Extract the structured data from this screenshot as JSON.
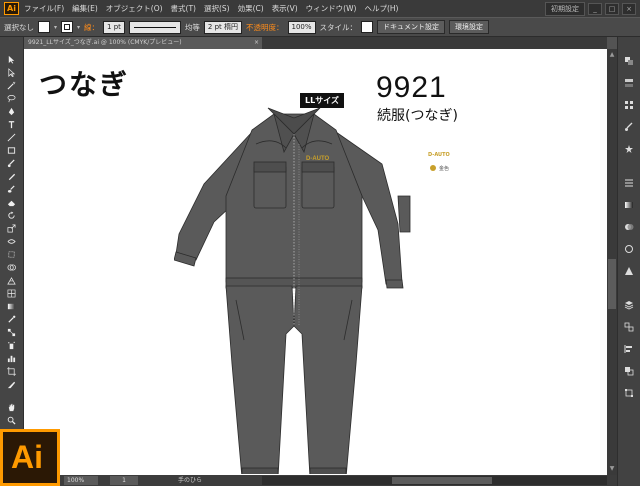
{
  "app": {
    "logo_text": "Ai",
    "accent_color": "#ff9a00"
  },
  "menu": {
    "items": [
      "ファイル(F)",
      "編集(E)",
      "オブジェクト(O)",
      "書式(T)",
      "選択(S)",
      "効果(C)",
      "表示(V)",
      "ウィンドウ(W)",
      "ヘルプ(H)"
    ],
    "workspace": "初期設定",
    "window_buttons": [
      "_",
      "□",
      "×"
    ]
  },
  "control_bar": {
    "selection": "選択なし",
    "stroke_label": "線：",
    "stroke_weight": "1 pt",
    "profile": "均等",
    "brush": "2 pt 楕円",
    "opacity_label": "不透明度：",
    "opacity": "100%",
    "style_label": "スタイル：",
    "document_setup": "ドキュメント設定",
    "preferences": "環境設定"
  },
  "document_tab": {
    "name": "9921_LLサイズ_つなぎ.ai @ 100% (CMYK/プレビュー)",
    "close": "×"
  },
  "artwork": {
    "title": "つなぎ",
    "size_badge": "LLサイズ",
    "product_code": "9921",
    "product_name": "続服(つなぎ)",
    "brand_label": "D-AUTO",
    "chest_logo": "D-AUTO",
    "color_label": "金色",
    "garment_color": "#5a5a5a",
    "logo_color": "#c8a02b"
  },
  "status_bar": {
    "zoom": "100%",
    "page": "1",
    "tool": "手のひら"
  },
  "tools": [
    "selection-tool-icon",
    "direct-selection-tool-icon",
    "magic-wand-tool-icon",
    "lasso-tool-icon",
    "pen-tool-icon",
    "type-tool-icon",
    "line-tool-icon",
    "rectangle-tool-icon",
    "paintbrush-tool-icon",
    "pencil-tool-icon",
    "blob-brush-tool-icon",
    "eraser-tool-icon",
    "rotate-tool-icon",
    "scale-tool-icon",
    "width-tool-icon",
    "free-transform-tool-icon",
    "shape-builder-tool-icon",
    "perspective-grid-tool-icon",
    "mesh-tool-icon",
    "gradient-tool-icon",
    "eyedropper-tool-icon",
    "blend-tool-icon",
    "symbol-sprayer-tool-icon",
    "column-graph-tool-icon",
    "artboard-tool-icon",
    "slice-tool-icon",
    "hand-tool-icon",
    "zoom-tool-icon"
  ],
  "panels": [
    "color-panel-icon",
    "color-guide-panel-icon",
    "swatches-panel-icon",
    "brushes-panel-icon",
    "symbols-panel-icon",
    "stroke-panel-icon",
    "gradient-panel-icon",
    "transparency-panel-icon",
    "appearance-panel-icon",
    "graphic-styles-panel-icon",
    "layers-panel-icon",
    "artboards-panel-icon",
    "align-panel-icon",
    "pathfinder-panel-icon",
    "transform-panel-icon"
  ]
}
